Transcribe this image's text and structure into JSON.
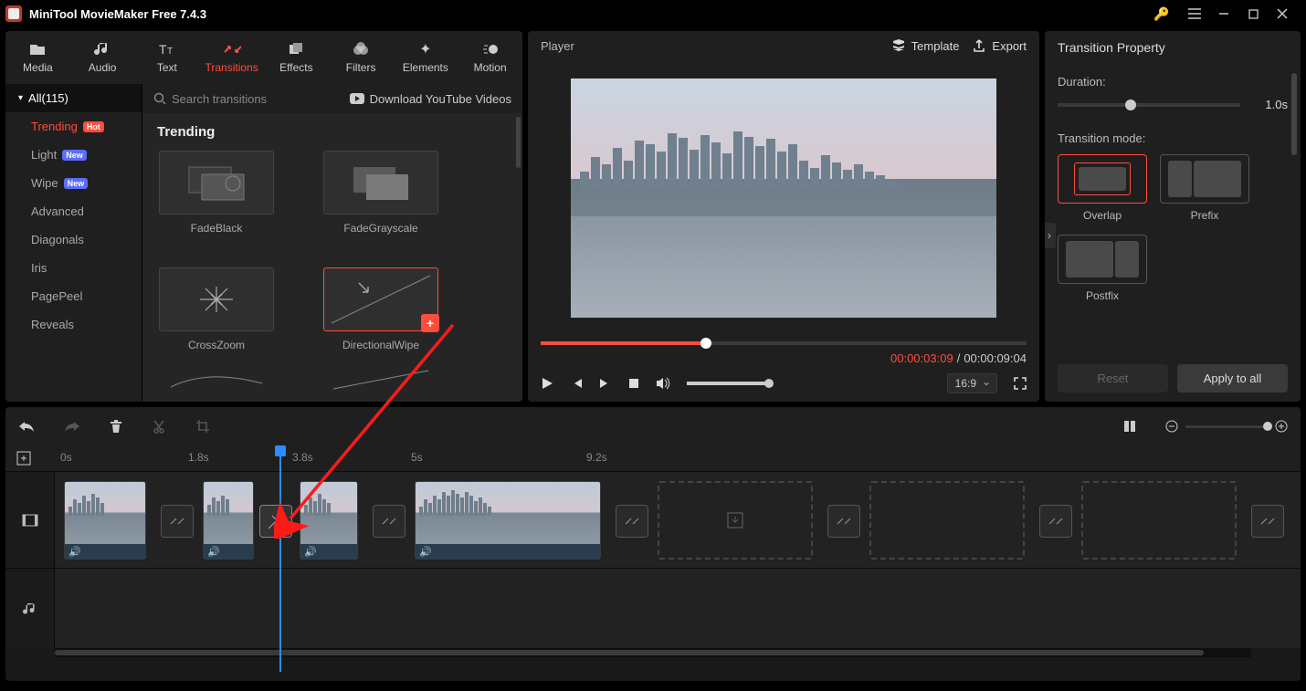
{
  "titlebar": {
    "title": "MiniTool MovieMaker Free 7.4.3"
  },
  "toolTabs": {
    "media": "Media",
    "audio": "Audio",
    "text": "Text",
    "transitions": "Transitions",
    "effects": "Effects",
    "filters": "Filters",
    "elements": "Elements",
    "motion": "Motion"
  },
  "library": {
    "allLabel": "All(115)",
    "searchPlaceholder": "Search transitions",
    "downloadLink": "Download YouTube Videos",
    "heading": "Trending",
    "categories": {
      "trending": "Trending",
      "light": "Light",
      "wipe": "Wipe",
      "advanced": "Advanced",
      "diagonals": "Diagonals",
      "iris": "Iris",
      "pagepeel": "PagePeel",
      "reveals": "Reveals"
    },
    "badges": {
      "hot": "Hot",
      "new": "New"
    },
    "thumbs": {
      "fadeblack": "FadeBlack",
      "fadegray": "FadeGrayscale",
      "crosszoom": "CrossZoom",
      "dirwipe": "DirectionalWipe"
    }
  },
  "player": {
    "title": "Player",
    "template": "Template",
    "export": "Export",
    "currentTime": "00:00:03:09",
    "separator": "/",
    "totalTime": "00:00:09:04",
    "aspect": "16:9"
  },
  "right": {
    "title": "Transition Property",
    "durationLabel": "Duration:",
    "durationValue": "1.0s",
    "modeLabel": "Transition mode:",
    "modes": {
      "overlap": "Overlap",
      "prefix": "Prefix",
      "postfix": "Postfix"
    },
    "reset": "Reset",
    "applyAll": "Apply to all"
  },
  "ruler": {
    "t0": "0s",
    "t1": "1.8s",
    "t2": "3.8s",
    "t3": "5s",
    "t4": "9.2s"
  }
}
